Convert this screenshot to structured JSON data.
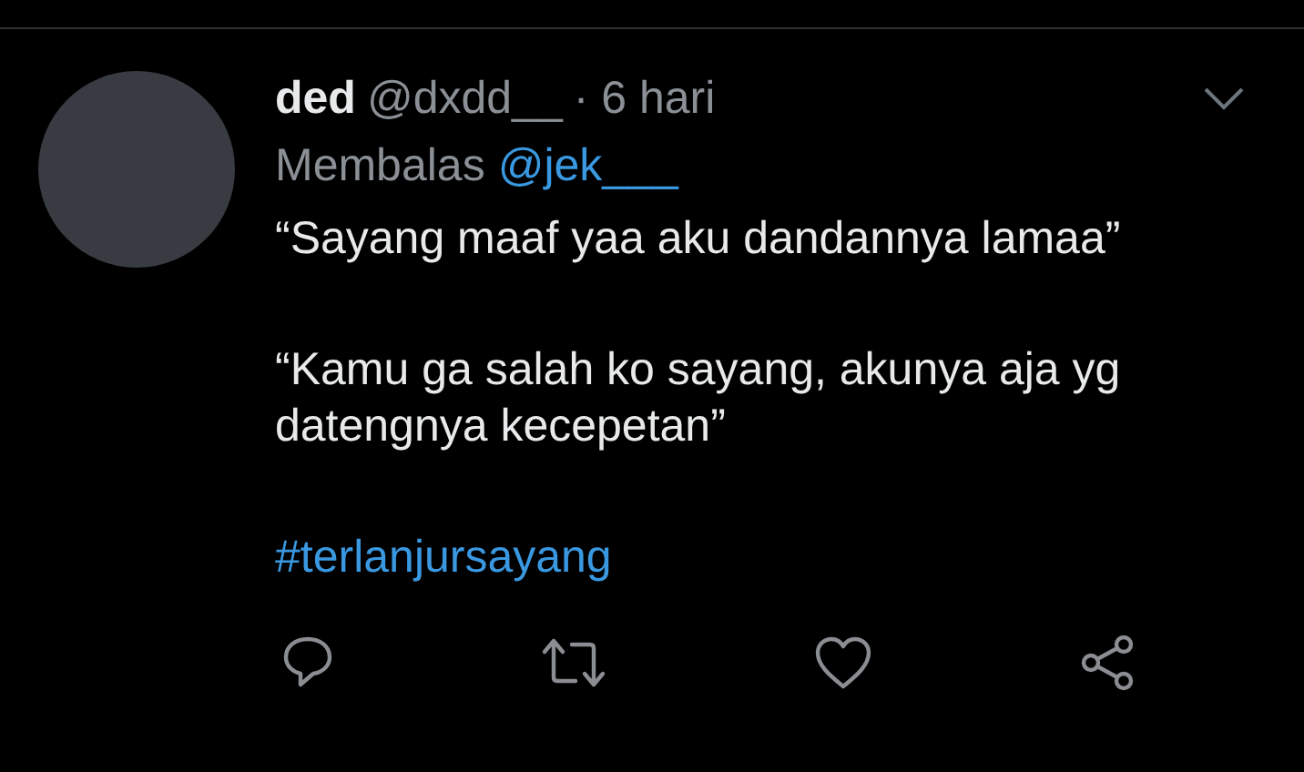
{
  "tweet": {
    "name": "ded",
    "handle": "@dxdd__",
    "time": "· 6 hari",
    "reply_label": "Membalas",
    "reply_mention": "@jek___",
    "paragraphs": [
      "“Sayang maaf yaa aku dandannya lamaa”",
      "“Kamu ga salah ko sayang, akunya aja yg datengnya kecepetan”"
    ],
    "hashtag": "#terlanjursayang",
    "actions": [
      {
        "kind": "reply"
      },
      {
        "kind": "retweet"
      },
      {
        "kind": "like"
      },
      {
        "kind": "share"
      }
    ]
  }
}
